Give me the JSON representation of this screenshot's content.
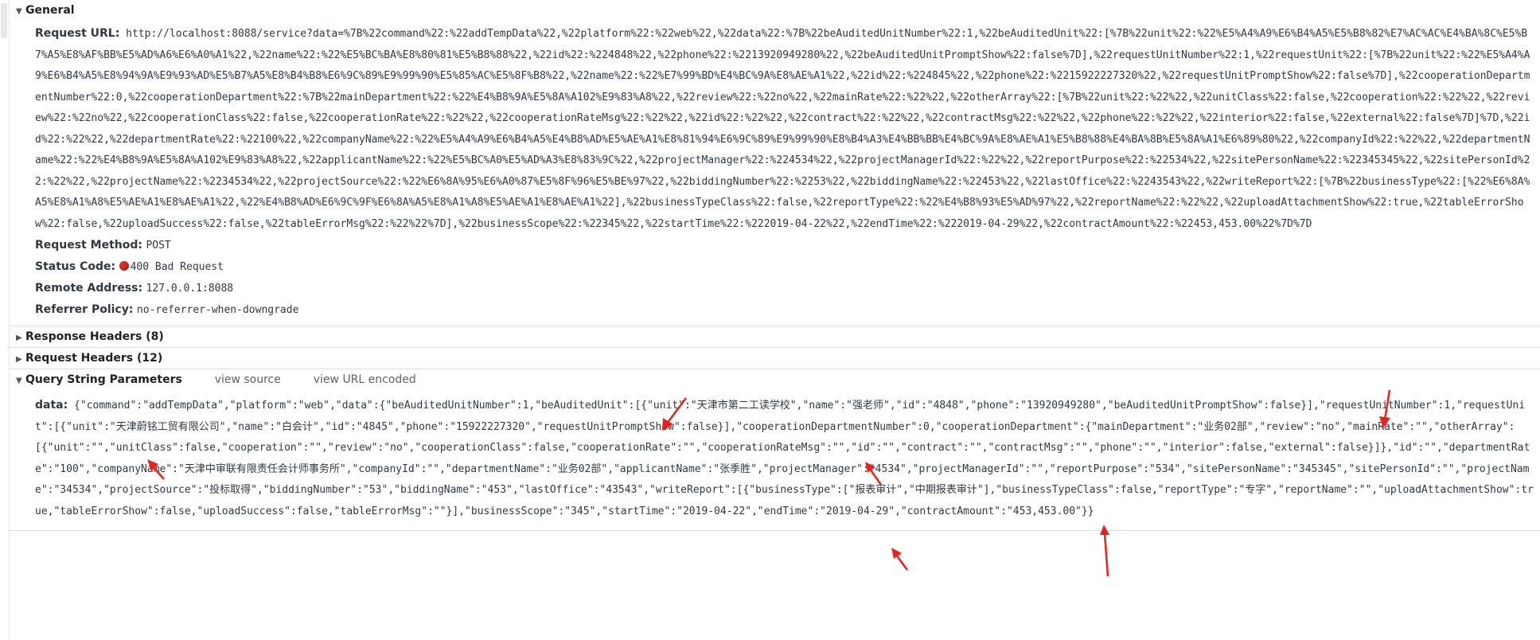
{
  "sections": {
    "general": "General",
    "response_headers": "Response Headers (8)",
    "request_headers": "Request Headers (12)",
    "query_string": "Query String Parameters",
    "view_source": "view source",
    "view_url_encoded": "view URL encoded"
  },
  "general": {
    "request_url_label": "Request URL:",
    "request_url": "http://localhost:8088/service?data=%7B%22command%22:%22addTempData%22,%22platform%22:%22web%22,%22data%22:%7B%22beAuditedUnitNumber%22:1,%22beAuditedUnit%22:[%7B%22unit%22:%22%E5%A4%A9%E6%B4%A5%E5%B8%82%E7%AC%AC%E4%BA%8C%E5%B7%A5%E8%AF%BB%E5%AD%A6%E6%A0%A1%22,%22name%22:%22%E5%BC%BA%E8%80%81%E5%B8%88%22,%22id%22:%224848%22,%22phone%22:%2213920949280%22,%22beAuditedUnitPromptShow%22:false%7D],%22requestUnitNumber%22:1,%22requestUnit%22:[%7B%22unit%22:%22%E5%A4%A9%E6%B4%A5%E8%94%9A%E9%93%AD%E5%B7%A5%E8%B4%B8%E6%9C%89%E9%99%90%E5%85%AC%E5%8F%B8%22,%22name%22:%22%E7%99%BD%E4%BC%9A%E8%AE%A1%22,%22id%22:%224845%22,%22phone%22:%2215922227320%22,%22requestUnitPromptShow%22:false%7D],%22cooperationDepartmentNumber%22:0,%22cooperationDepartment%22:%7B%22mainDepartment%22:%22%E4%B8%9A%E5%8A%A102%E9%83%A8%22,%22review%22:%22no%22,%22mainRate%22:%22%22,%22otherArray%22:[%7B%22unit%22:%22%22,%22unitClass%22:false,%22cooperation%22:%22%22,%22review%22:%22no%22,%22cooperationClass%22:false,%22cooperationRate%22:%22%22,%22cooperationRateMsg%22:%22%22,%22id%22:%22%22,%22contract%22:%22%22,%22contractMsg%22:%22%22,%22phone%22:%22%22,%22interior%22:false,%22external%22:false%7D]%7D,%22id%22:%22%22,%22departmentRate%22:%22100%22,%22companyName%22:%22%E5%A4%A9%E6%B4%A5%E4%B8%AD%E5%AE%A1%E8%81%94%E6%9C%89%E9%99%90%E8%B4%A3%E4%BB%BB%E4%BC%9A%E8%AE%A1%E5%B8%88%E4%BA%8B%E5%8A%A1%E6%89%80%22,%22companyId%22:%22%22,%22departmentName%22:%22%E4%B8%9A%E5%8A%A102%E9%83%A8%22,%22applicantName%22:%22%E5%BC%A0%E5%AD%A3%E8%83%9C%22,%22projectManager%22:%224534%22,%22projectManagerId%22:%22%22,%22reportPurpose%22:%22534%22,%22sitePersonName%22:%22345345%22,%22sitePersonId%22:%22%22,%22projectName%22:%2234534%22,%22projectSource%22:%22%E6%8A%95%E6%A0%87%E5%8F%96%E5%BE%97%22,%22biddingNumber%22:%2253%22,%22biddingName%22:%22453%22,%22lastOffice%22:%2243543%22,%22writeReport%22:[%7B%22businessType%22:[%22%E6%8A%A5%E8%A1%A8%E5%AE%A1%E8%AE%A1%22,%22%E4%B8%AD%E6%9C%9F%E6%8A%A5%E8%A1%A8%E5%AE%A1%E8%AE%A1%22],%22businessTypeClass%22:false,%22reportType%22:%22%E4%B8%93%E5%AD%97%22,%22reportName%22:%22%22,%22uploadAttachmentShow%22:true,%22tableErrorShow%22:false,%22uploadSuccess%22:false,%22tableErrorMsg%22:%22%22%7D],%22businessScope%22:%22345%22,%22startTime%22:%222019-04-22%22,%22endTime%22:%222019-04-29%22,%22contractAmount%22:%22453,453.00%22%7D%7D",
    "request_method_label": "Request Method:",
    "request_method": "POST",
    "status_code_label": "Status Code:",
    "status_code": "400 Bad Request",
    "remote_address_label": "Remote Address:",
    "remote_address": "127.0.0.1:8088",
    "referrer_policy_label": "Referrer Policy:",
    "referrer_policy": "no-referrer-when-downgrade"
  },
  "query": {
    "param_label": "data:",
    "param_value": "{\"command\":\"addTempData\",\"platform\":\"web\",\"data\":{\"beAuditedUnitNumber\":1,\"beAuditedUnit\":[{\"unit\":\"天津市第二工读学校\",\"name\":\"强老师\",\"id\":\"4848\",\"phone\":\"13920949280\",\"beAuditedUnitPromptShow\":false}],\"requestUnitNumber\":1,\"requestUnit\":[{\"unit\":\"天津蔚铭工贸有限公司\",\"name\":\"白会计\",\"id\":\"4845\",\"phone\":\"15922227320\",\"requestUnitPromptShow\":false}],\"cooperationDepartmentNumber\":0,\"cooperationDepartment\":{\"mainDepartment\":\"业务02部\",\"review\":\"no\",\"mainRate\":\"\",\"otherArray\":[{\"unit\":\"\",\"unitClass\":false,\"cooperation\":\"\",\"review\":\"no\",\"cooperationClass\":false,\"cooperationRate\":\"\",\"cooperationRateMsg\":\"\",\"id\":\"\",\"contract\":\"\",\"contractMsg\":\"\",\"phone\":\"\",\"interior\":false,\"external\":false}]},\"id\":\"\",\"departmentRate\":\"100\",\"companyName\":\"天津中审联有限责任会计师事务所\",\"companyId\":\"\",\"departmentName\":\"业务02部\",\"applicantName\":\"张季胜\",\"projectManager\":\"4534\",\"projectManagerId\":\"\",\"reportPurpose\":\"534\",\"sitePersonName\":\"345345\",\"sitePersonId\":\"\",\"projectName\":\"34534\",\"projectSource\":\"投标取得\",\"biddingNumber\":\"53\",\"biddingName\":\"453\",\"lastOffice\":\"43543\",\"writeReport\":[{\"businessType\":[\"报表审计\",\"中期报表审计\"],\"businessTypeClass\":false,\"reportType\":\"专字\",\"reportName\":\"\",\"uploadAttachmentShow\":true,\"tableErrorShow\":false,\"uploadSuccess\":false,\"tableErrorMsg\":\"\"}],\"businessScope\":\"345\",\"startTime\":\"2019-04-22\",\"endTime\":\"2019-04-29\",\"contractAmount\":\"453,453.00\"}}"
  },
  "icons": {
    "expanded": "▼",
    "collapsed": "▶",
    "annotation_color": "#e8231b",
    "status_color": "#d93025"
  }
}
